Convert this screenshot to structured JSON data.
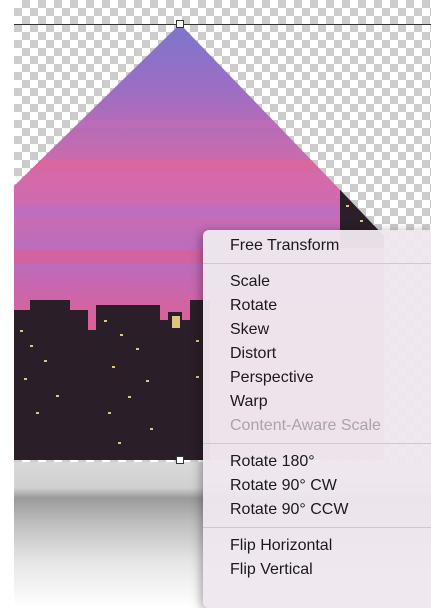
{
  "context_menu": {
    "groups": [
      [
        {
          "label": "Free Transform",
          "enabled": true
        }
      ],
      [
        {
          "label": "Scale",
          "enabled": true
        },
        {
          "label": "Rotate",
          "enabled": true
        },
        {
          "label": "Skew",
          "enabled": true
        },
        {
          "label": "Distort",
          "enabled": true
        },
        {
          "label": "Perspective",
          "enabled": true
        },
        {
          "label": "Warp",
          "enabled": true
        },
        {
          "label": "Content-Aware Scale",
          "enabled": false
        }
      ],
      [
        {
          "label": "Rotate 180°",
          "enabled": true
        },
        {
          "label": "Rotate 90° CW",
          "enabled": true
        },
        {
          "label": "Rotate 90° CCW",
          "enabled": true
        }
      ],
      [
        {
          "label": "Flip Horizontal",
          "enabled": true
        },
        {
          "label": "Flip Vertical",
          "enabled": true
        }
      ]
    ]
  },
  "colors": {
    "sky_top": "#7a78c8",
    "sky_mid": "#d4679f",
    "sky_low": "#e05a8a",
    "buildings": "#2a1e28",
    "window_light": "#f3d98a",
    "disabled_text": "#a8a4a8"
  }
}
